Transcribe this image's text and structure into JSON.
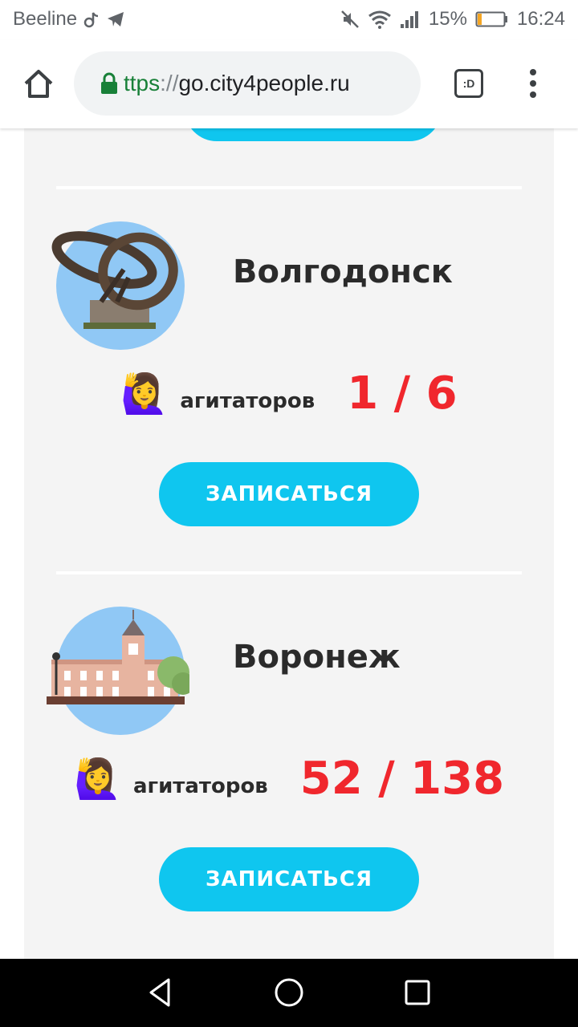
{
  "status_bar": {
    "carrier": "Beeline",
    "battery_percent": "15%",
    "battery_level": 0.15,
    "time": "16:24",
    "icons": [
      "tiktok-icon",
      "telegram-icon",
      "mute-icon",
      "wifi-icon",
      "signal-icon",
      "battery-icon"
    ]
  },
  "browser": {
    "url_scheme_fragment": "ttps",
    "url_separator": "://",
    "url_host": "go.city4people.ru",
    "tab_label": ":D",
    "icons": [
      "home-icon",
      "lock-icon",
      "tab-switcher-icon",
      "more-vert-icon"
    ]
  },
  "cities": [
    {
      "name": "Волгодонск",
      "emoji": "🙋‍♀️",
      "label": "агитаторов",
      "value": "1 / 6",
      "button": "ЗАПИСАТЬСЯ",
      "image_icon": "sculpture-rings-icon"
    },
    {
      "name": "Воронеж",
      "emoji": "🙋‍♀️",
      "label": "агитаторов",
      "value": "52 / 138",
      "button": "ЗАПИСАТЬСЯ",
      "image_icon": "building-tower-icon"
    }
  ],
  "colors": {
    "accent": "#0fc6ef",
    "counter": "#f0272d",
    "card_bg": "#f4f4f4",
    "avatar_bg": "#90c8f5"
  },
  "nav_bar": {
    "icons": [
      "back-icon",
      "home-circle-icon",
      "recents-icon"
    ]
  }
}
